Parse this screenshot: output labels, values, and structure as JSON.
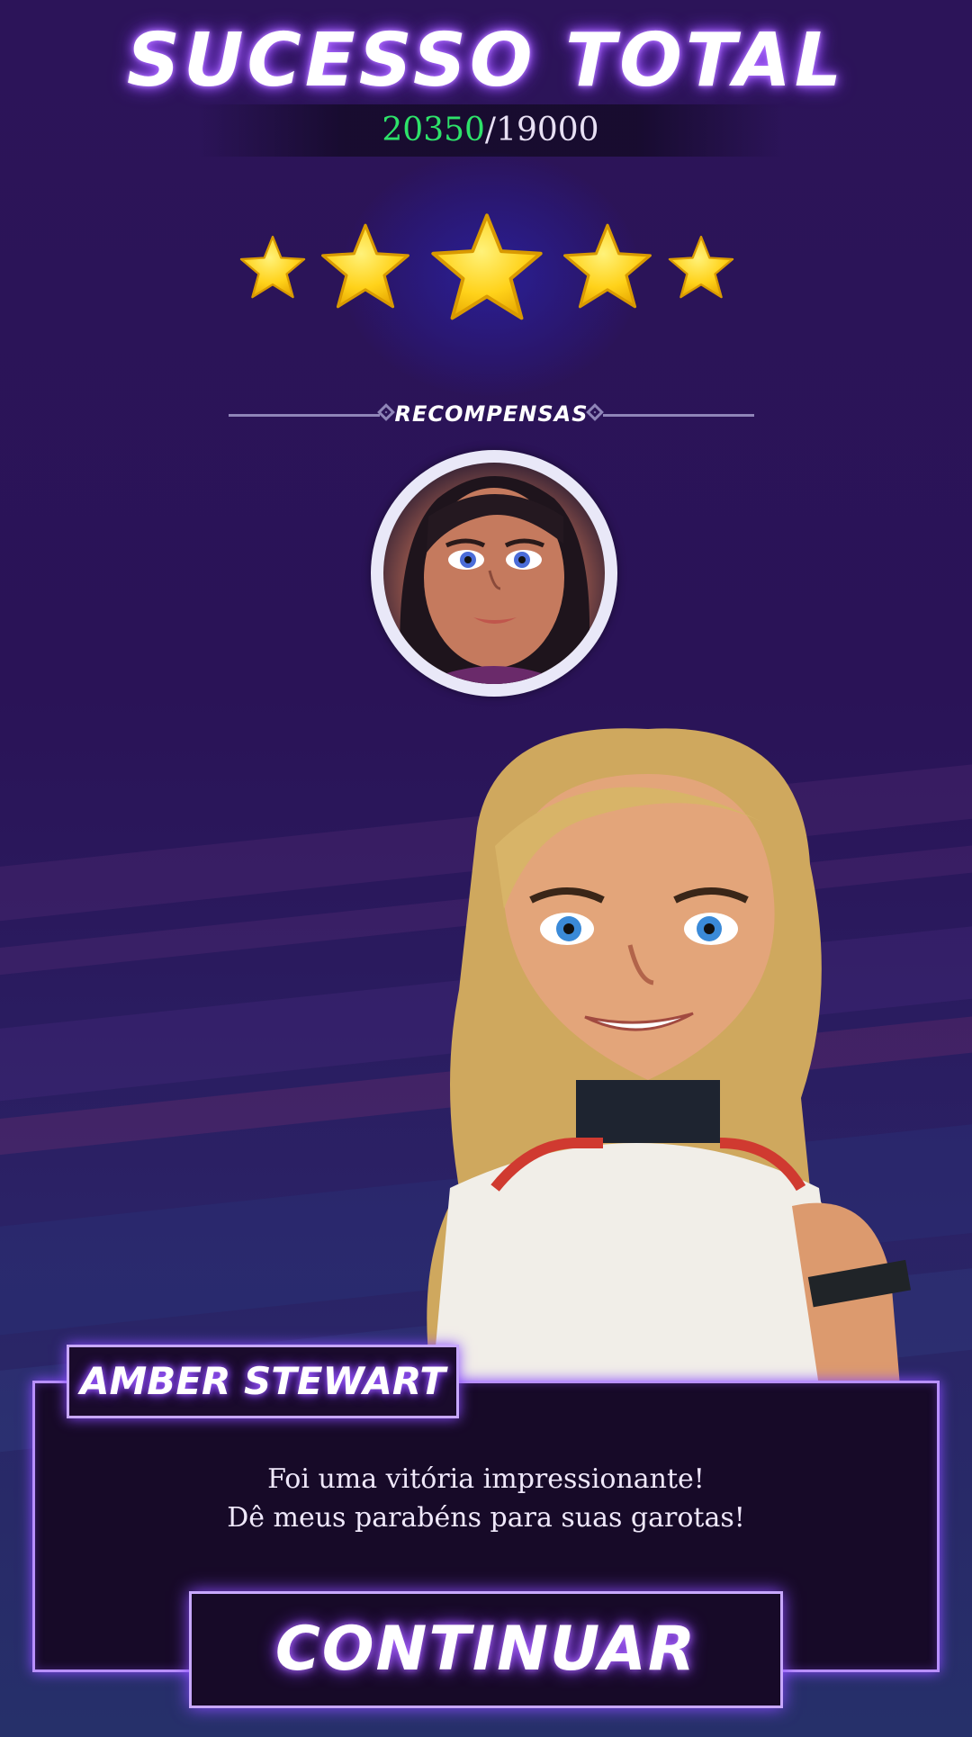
{
  "header": {
    "title": "SUCESSO TOTAL",
    "score_current": "20350",
    "score_separator": "/",
    "score_target": "19000"
  },
  "rating": {
    "stars_earned": 5,
    "stars_total": 5,
    "icon": "star-icon"
  },
  "rewards": {
    "label": "RECOMPENSAS",
    "items": [
      {
        "type": "character-portrait",
        "icon": "avatar-portrait"
      }
    ]
  },
  "dialog": {
    "speaker": "AMBER STEWART",
    "line1": "Foi uma vitória impressionante!",
    "line2": "Dê meus parabéns para suas garotas!"
  },
  "actions": {
    "continue_label": "CONTINUAR"
  },
  "colors": {
    "accent": "#b890ff",
    "score_good": "#2ee26a",
    "star": "#ffd21a",
    "background": "#2a1456"
  }
}
